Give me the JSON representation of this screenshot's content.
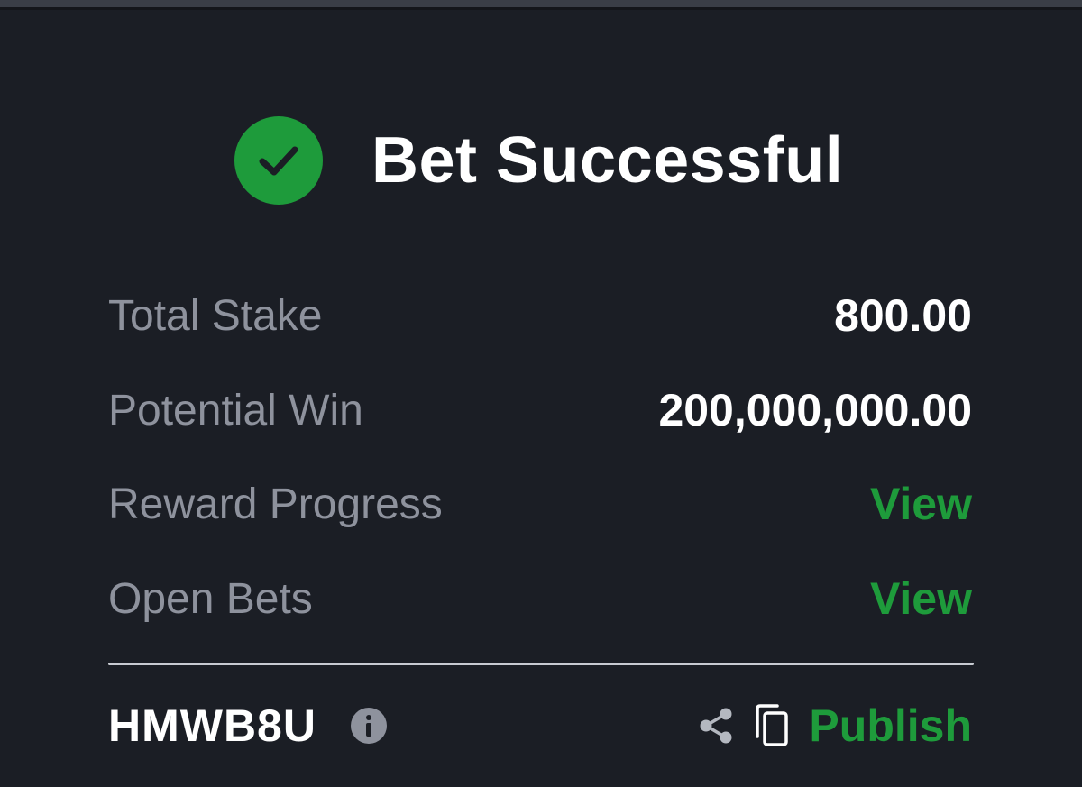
{
  "header": {
    "title": "Bet Successful",
    "icon": "check-circle-icon",
    "accent": "#1e9b3b"
  },
  "rows": [
    {
      "label": "Total Stake",
      "value": "800.00"
    },
    {
      "label": "Potential Win",
      "value": "200,000,000.00"
    },
    {
      "label": "Reward Progress",
      "value": "View"
    },
    {
      "label": "Open Bets",
      "value": "View"
    }
  ],
  "footer": {
    "booking_code": "HMWB8U",
    "info_icon": "info-icon",
    "share_icon": "share-icon",
    "copy_icon": "copy-icon",
    "publish_label": "Publish"
  }
}
